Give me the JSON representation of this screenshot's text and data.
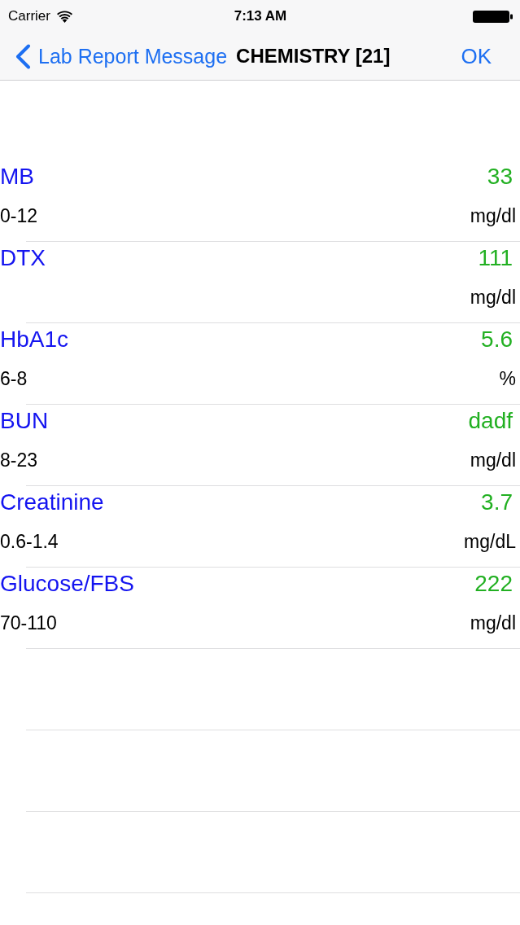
{
  "status_bar": {
    "carrier": "Carrier",
    "time": "7:13 AM"
  },
  "nav_bar": {
    "back_label": "Lab Report Message",
    "title": "CHEMISTRY [21]",
    "action": "OK"
  },
  "results": [
    {
      "name": "MB",
      "value": "33",
      "range": "0-12",
      "unit": "mg/dl"
    },
    {
      "name": "DTX",
      "value": "111",
      "unit": "mg/dl"
    },
    {
      "name": "HbA1c",
      "value": "5.6",
      "range": "6-8",
      "unit": "%"
    },
    {
      "name": "BUN",
      "value": "dadf",
      "range": "8-23",
      "unit": "mg/dl"
    },
    {
      "name": "Creatinine",
      "value": "3.7",
      "range": "0.6-1.4",
      "unit": "mg/dL"
    },
    {
      "name": "Glucose/FBS",
      "value": "222",
      "range": "70-110",
      "unit": "mg/dl"
    }
  ]
}
